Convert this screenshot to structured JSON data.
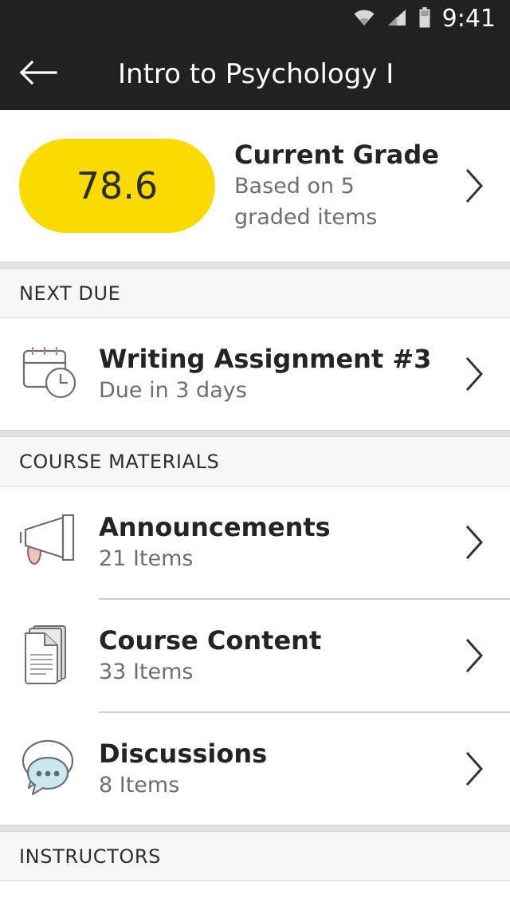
{
  "status_bar": {
    "time": "9:41",
    "icons": [
      "wifi-icon",
      "cellular-signal-icon",
      "battery-icon"
    ],
    "background": "#212121"
  },
  "app_bar": {
    "back_icon": "back-arrow-icon",
    "title": "Intro to Psychology I",
    "background": "#212121",
    "text_color": "#ffffff"
  },
  "grade_card": {
    "value": "78.6",
    "title": "Current Grade",
    "subtitle": "Based on 5 graded items",
    "pill_color": "#FADB00",
    "chevron_icon": "chevron-right-icon"
  },
  "sections": [
    {
      "header": "NEXT DUE",
      "rows": [
        {
          "icon": "calendar-clock-icon",
          "title": "Writing Assignment #3",
          "subtitle": "Due in 3 days",
          "chevron_icon": "chevron-right-icon"
        }
      ]
    },
    {
      "header": "COURSE MATERIALS",
      "rows": [
        {
          "icon": "megaphone-icon",
          "title": "Announcements",
          "subtitle": "21 Items",
          "chevron_icon": "chevron-right-icon"
        },
        {
          "icon": "documents-icon",
          "title": "Course Content",
          "subtitle": "33 Items",
          "chevron_icon": "chevron-right-icon"
        },
        {
          "icon": "discussion-bubbles-icon",
          "title": "Discussions",
          "subtitle": "8 Items",
          "chevron_icon": "chevron-right-icon"
        }
      ]
    },
    {
      "header": "INSTRUCTORS",
      "rows": []
    }
  ],
  "colors": {
    "accent_yellow": "#FADB00",
    "icon_stroke": "#6e6e6e",
    "title_text": "#242424",
    "subtitle_text": "#6e6e6e",
    "section_bg": "#f6f6f6",
    "megaphone_handle": "#f3c0c0",
    "bubble_fill": "#c7e9ef"
  }
}
